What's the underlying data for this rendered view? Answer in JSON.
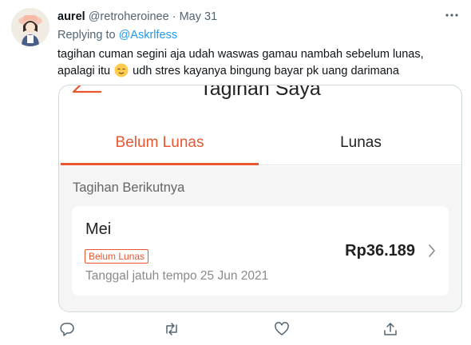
{
  "tweet": {
    "display_name": "aurel",
    "handle": "@retroheroinee",
    "separator": "·",
    "date": "May 31",
    "replying_prefix": "Replying to ",
    "replying_to": "@Askrlfess",
    "text_part1": "tagihan cuman segini aja udah waswas gamau nambah sebelum lunas, apalagi itu",
    "emoji": "relieved-face-emoji",
    "text_part2": "udh stres kayanya bingung bayar pk uang darimana"
  },
  "screenshot": {
    "title": "Tagihan Saya",
    "tabs": [
      {
        "label": "Belum Lunas",
        "active": true
      },
      {
        "label": "Lunas",
        "active": false
      }
    ],
    "section_label": "Tagihan Berikutnya",
    "bill": {
      "month": "Mei",
      "status_badge": "Belum Lunas",
      "amount": "Rp36.189",
      "due_text": "Tanggal jatuh tempo 25 Jun 2021"
    },
    "accent_color": "#e9562f"
  },
  "actions": [
    "reply-icon",
    "retweet-icon",
    "like-icon",
    "share-icon"
  ],
  "colors": {
    "link": "#1d9bf0",
    "muted": "#536471",
    "icon": "#536471"
  }
}
